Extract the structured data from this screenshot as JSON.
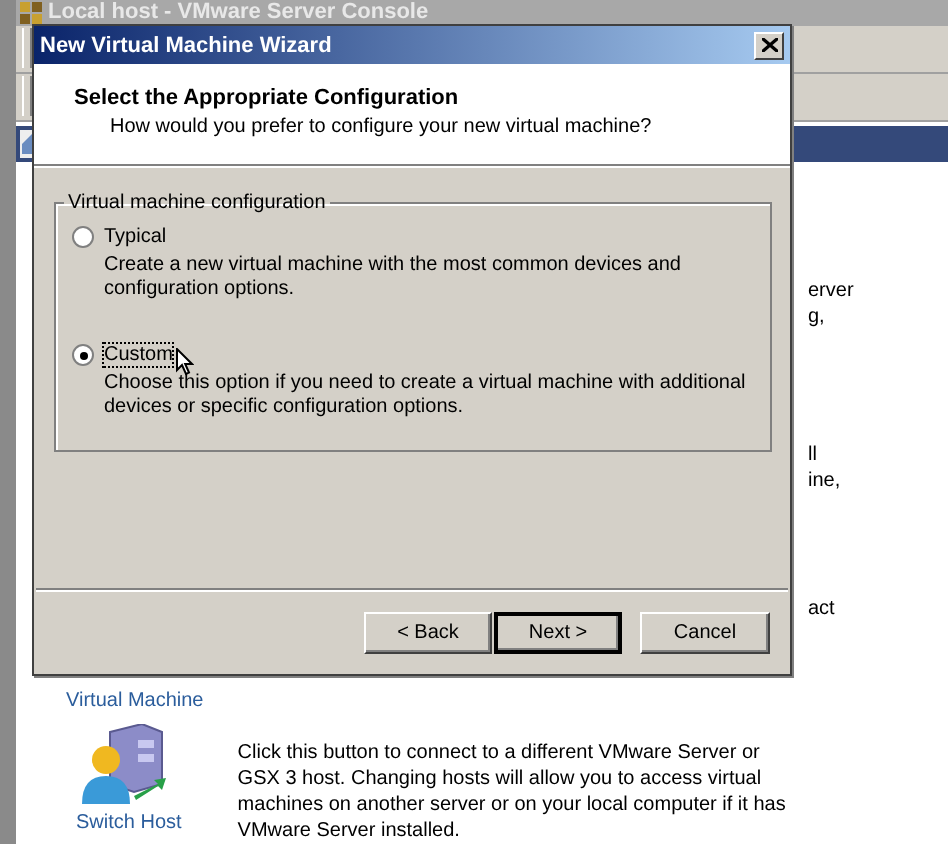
{
  "console_window": {
    "title": "Local host - VMware Server Console",
    "side_text": [
      "erver",
      "g,",
      "ll",
      "ine,",
      "act"
    ],
    "virtual_machine_label": "Virtual Machine",
    "switch_host": {
      "label": "Switch Host",
      "description": "Click this button to connect to a different VMware Server or GSX 3 host. Changing hosts will allow you to access virtual machines on another server or on your local computer if it has VMware Server installed."
    }
  },
  "dialog": {
    "title": "New Virtual Machine Wizard",
    "heading": "Select the Appropriate Configuration",
    "subheading": "How would you prefer to configure your new virtual machine?",
    "group": {
      "label": "Virtual machine configuration",
      "options": [
        {
          "label": "Typical",
          "description": "Create a new virtual machine with the most common devices and configuration options.",
          "selected": false,
          "focused": false
        },
        {
          "label": "Custom",
          "description": "Choose this option if you need to create a virtual machine with additional devices or specific configuration options.",
          "selected": true,
          "focused": true
        }
      ]
    },
    "buttons": [
      {
        "label": "< Back",
        "default": false
      },
      {
        "label": "Next >",
        "default": true
      },
      {
        "label": "Cancel",
        "default": false
      }
    ]
  }
}
